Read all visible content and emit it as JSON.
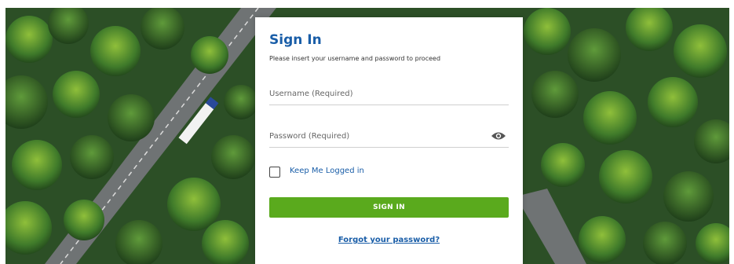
{
  "signin": {
    "title": "Sign In",
    "subtitle": "Please insert your username and password to proceed",
    "username_placeholder": "Username (Required)",
    "password_placeholder": "Password (Required)",
    "keep_logged_in_label": "Keep Me Logged in",
    "submit_label": "SIGN IN",
    "forgot_link": "Forgot your password?"
  },
  "colors": {
    "accent": "#1a5ea8",
    "button": "#5aaa1d"
  },
  "icons": {
    "password_toggle": "eye-icon"
  }
}
